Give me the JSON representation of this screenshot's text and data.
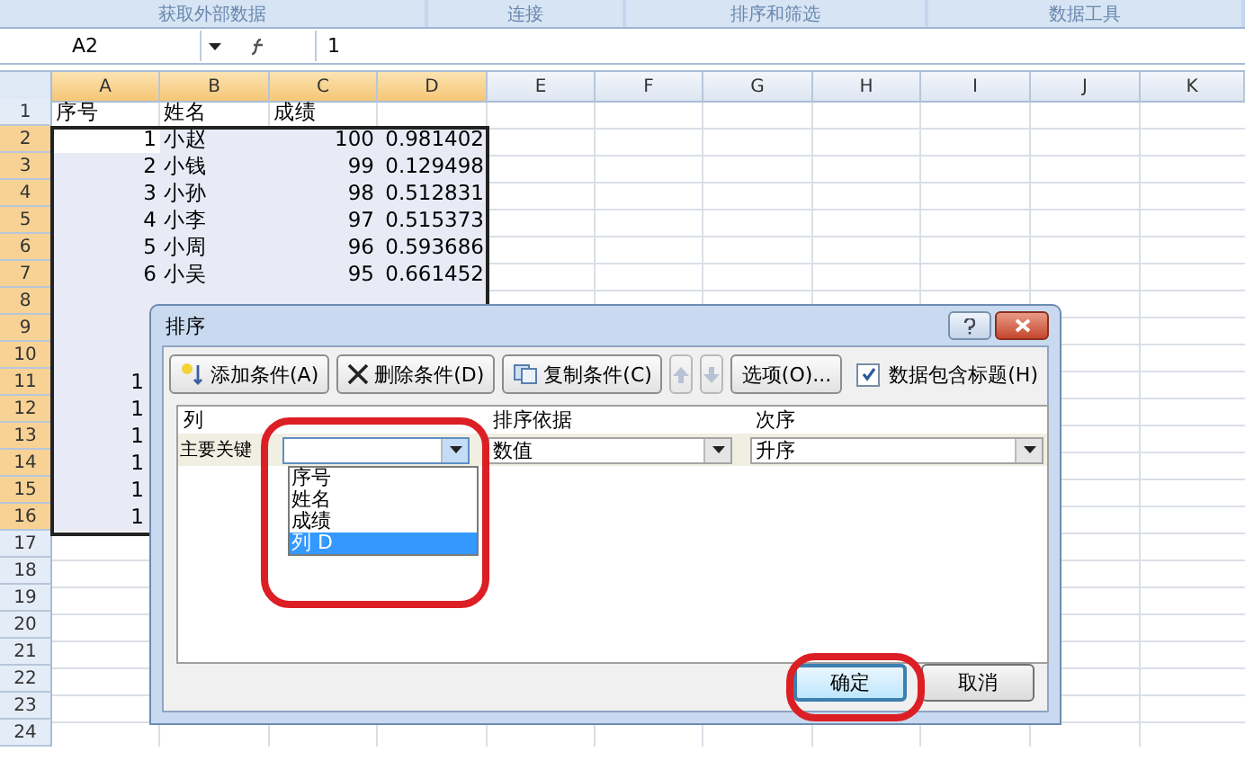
{
  "ribbon_groups": [
    {
      "label": "获取外部数据"
    },
    {
      "label": "连接"
    },
    {
      "label": "排序和筛选"
    },
    {
      "label": "数据工具"
    }
  ],
  "formula_bar": {
    "name_box": "A2",
    "value": "1"
  },
  "columns": [
    {
      "label": "A",
      "selected": true
    },
    {
      "label": "B",
      "selected": true
    },
    {
      "label": "C",
      "selected": true
    },
    {
      "label": "D",
      "selected": true
    },
    {
      "label": "E",
      "selected": false
    },
    {
      "label": "F",
      "selected": false
    },
    {
      "label": "G",
      "selected": false
    },
    {
      "label": "H",
      "selected": false
    },
    {
      "label": "I",
      "selected": false
    },
    {
      "label": "J",
      "selected": false
    },
    {
      "label": "K",
      "selected": false
    }
  ],
  "rows": [
    {
      "number": "1",
      "selected": false,
      "cells": [
        {
          "text": "序号",
          "kind": "text",
          "active": false
        },
        {
          "text": "姓名",
          "kind": "text",
          "active": false
        },
        {
          "text": "成绩",
          "kind": "text",
          "active": false
        }
      ]
    },
    {
      "number": "2",
      "selected": true,
      "cells": [
        {
          "text": "1",
          "kind": "number",
          "active": true
        },
        {
          "text": "小赵",
          "kind": "text",
          "active": false
        },
        {
          "text": "100",
          "kind": "number",
          "active": false
        },
        {
          "text": "0.981402",
          "kind": "number",
          "active": false
        }
      ]
    },
    {
      "number": "3",
      "selected": true,
      "cells": [
        {
          "text": "2",
          "kind": "number",
          "active": false
        },
        {
          "text": "小钱",
          "kind": "text",
          "active": false
        },
        {
          "text": "99",
          "kind": "number",
          "active": false
        },
        {
          "text": "0.129498",
          "kind": "number",
          "active": false
        }
      ]
    },
    {
      "number": "4",
      "selected": true,
      "cells": [
        {
          "text": "3",
          "kind": "number",
          "active": false
        },
        {
          "text": "小孙",
          "kind": "text",
          "active": false
        },
        {
          "text": "98",
          "kind": "number",
          "active": false
        },
        {
          "text": "0.512831",
          "kind": "number",
          "active": false
        }
      ]
    },
    {
      "number": "5",
      "selected": true,
      "cells": [
        {
          "text": "4",
          "kind": "number",
          "active": false
        },
        {
          "text": "小李",
          "kind": "text",
          "active": false
        },
        {
          "text": "97",
          "kind": "number",
          "active": false
        },
        {
          "text": "0.515373",
          "kind": "number",
          "active": false
        }
      ]
    },
    {
      "number": "6",
      "selected": true,
      "cells": [
        {
          "text": "5",
          "kind": "number",
          "active": false
        },
        {
          "text": "小周",
          "kind": "text",
          "active": false
        },
        {
          "text": "96",
          "kind": "number",
          "active": false
        },
        {
          "text": "0.593686",
          "kind": "number",
          "active": false
        }
      ]
    },
    {
      "number": "7",
      "selected": true,
      "cells": [
        {
          "text": "6",
          "kind": "number",
          "active": false
        },
        {
          "text": "小吴",
          "kind": "text",
          "active": false
        },
        {
          "text": "95",
          "kind": "number",
          "active": false
        },
        {
          "text": "0.661452",
          "kind": "number",
          "active": false
        }
      ]
    },
    {
      "number": "8",
      "selected": true
    },
    {
      "number": "9",
      "selected": true
    },
    {
      "number": "10",
      "selected": true
    },
    {
      "number": "11",
      "selected": true,
      "cells": [
        {
          "text": "1",
          "kind": "partial",
          "active": false
        }
      ]
    },
    {
      "number": "12",
      "selected": true,
      "cells": [
        {
          "text": "1",
          "kind": "partial",
          "active": false
        }
      ]
    },
    {
      "number": "13",
      "selected": true,
      "cells": [
        {
          "text": "1",
          "kind": "partial",
          "active": false
        }
      ]
    },
    {
      "number": "14",
      "selected": true,
      "cells": [
        {
          "text": "1",
          "kind": "partial",
          "active": false
        }
      ]
    },
    {
      "number": "15",
      "selected": true,
      "cells": [
        {
          "text": "1",
          "kind": "partial",
          "active": false
        }
      ]
    },
    {
      "number": "16",
      "selected": true,
      "cells": [
        {
          "text": "1",
          "kind": "partial",
          "active": false
        }
      ]
    },
    {
      "number": "17",
      "selected": false
    },
    {
      "number": "18",
      "selected": false
    },
    {
      "number": "19",
      "selected": false
    },
    {
      "number": "20",
      "selected": false
    },
    {
      "number": "21",
      "selected": false
    },
    {
      "number": "22",
      "selected": false
    },
    {
      "number": "23",
      "selected": false
    },
    {
      "number": "24",
      "selected": false
    }
  ],
  "dialog": {
    "title": "排序",
    "toolbar": [
      {
        "label": "添加条件(A)",
        "kind": "add"
      },
      {
        "label": "删除条件(D)",
        "kind": "delete"
      },
      {
        "label": "复制条件(C)",
        "kind": "copy"
      },
      {
        "kind": "up",
        "disabled": true
      },
      {
        "kind": "down",
        "disabled": true
      },
      {
        "label": "选项(O)...",
        "kind": "plain"
      }
    ],
    "header_checkbox": {
      "label": "数据包含标题(H)",
      "checked": true
    },
    "columns": [
      "列",
      "排序依据",
      "次序"
    ],
    "row": {
      "label": "主要关键",
      "column": {
        "expanded": true,
        "options": [
          {
            "label": "序号",
            "selected": false
          },
          {
            "label": "姓名",
            "selected": false
          },
          {
            "label": "成绩",
            "selected": false
          },
          {
            "label": "列 D",
            "selected": true
          }
        ]
      },
      "sort_on": "数值",
      "order": "升序"
    },
    "buttons": [
      {
        "label": "确定",
        "focused": true
      },
      {
        "label": "取消",
        "focused": false
      }
    ]
  }
}
